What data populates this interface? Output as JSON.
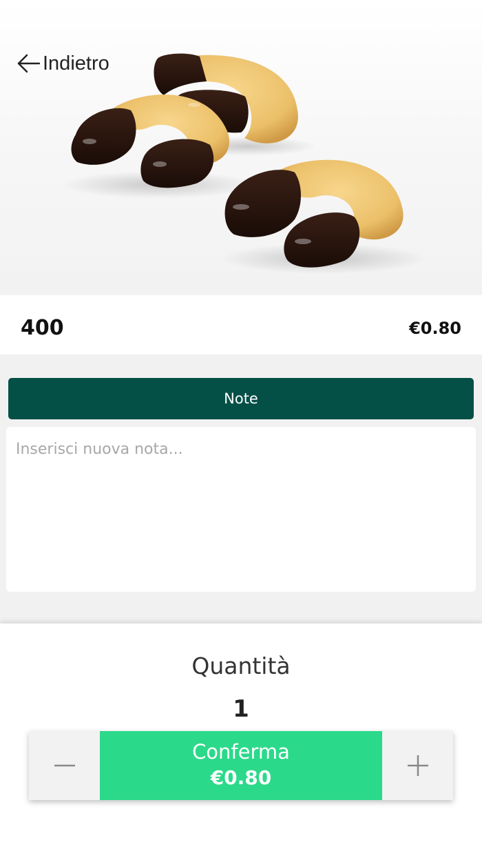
{
  "header": {
    "back_label": "Indietro"
  },
  "product": {
    "name": "400",
    "price": "€0.80",
    "image_icon": "cookie-photo"
  },
  "notes": {
    "title": "Note",
    "placeholder": "Inserisci nuova nota...",
    "value": ""
  },
  "quantity": {
    "label": "Quantità",
    "value": "1"
  },
  "actions": {
    "confirm_label": "Conferma",
    "confirm_price": "€0.80",
    "decrement_icon": "minus-icon",
    "increment_icon": "plus-icon"
  },
  "colors": {
    "notes_bar": "#044f46",
    "confirm": "#2bd98a",
    "background_gray": "#f1f1f1"
  }
}
